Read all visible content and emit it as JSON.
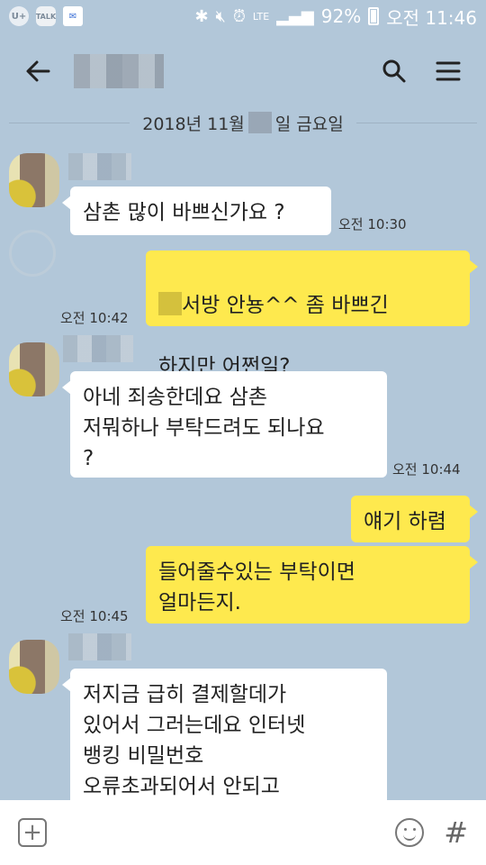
{
  "status_bar": {
    "apps": [
      "U+",
      "TALK",
      "msg"
    ],
    "icons": [
      "bluetooth-icon",
      "mute-icon",
      "alarm-icon",
      "lte-icon",
      "signal-icon",
      "battery-icon"
    ],
    "lte": "LTE",
    "battery": "92%",
    "time": "오전 11:46"
  },
  "header": {
    "icons": [
      "back-arrow-icon",
      "search-icon",
      "menu-icon"
    ]
  },
  "date_divider": {
    "prefix": "2018년 11월",
    "suffix": "일 금요일"
  },
  "messages": [
    {
      "side": "in",
      "text": "삼촌 많이 바쁘신가요 ?",
      "time": "오전 10:30"
    },
    {
      "side": "out",
      "text_after_blur": "서방 안뇽^^ 좀 바쁘긴",
      "text_line2": "하지만 어쩐일?",
      "time": "오전 10:42"
    },
    {
      "side": "in",
      "text": "아네 죄송한데요 삼촌\n저뭐하나 부탁드려도 되나요\n?",
      "time": "오전 10:44"
    },
    {
      "side": "out",
      "text": "얘기 하렴",
      "time": ""
    },
    {
      "side": "out",
      "text": "들어줄수있는 부탁이면\n얼마든지.",
      "time": "오전 10:45"
    },
    {
      "side": "in",
      "text": "저지금 급히 결제할데가\n있어서 그러는데요 인터넷\n뱅킹 비밀번호\n오류초과되어서 안되고",
      "time": ""
    }
  ],
  "input_bar": {
    "placeholder": "",
    "icons": [
      "plus-icon",
      "emoji-icon",
      "hash-icon"
    ],
    "hash": "#",
    "plus": "+"
  },
  "colors": {
    "background": "#b2c7d9",
    "outgoing_bubble": "#fee94e",
    "incoming_bubble": "#ffffff"
  }
}
